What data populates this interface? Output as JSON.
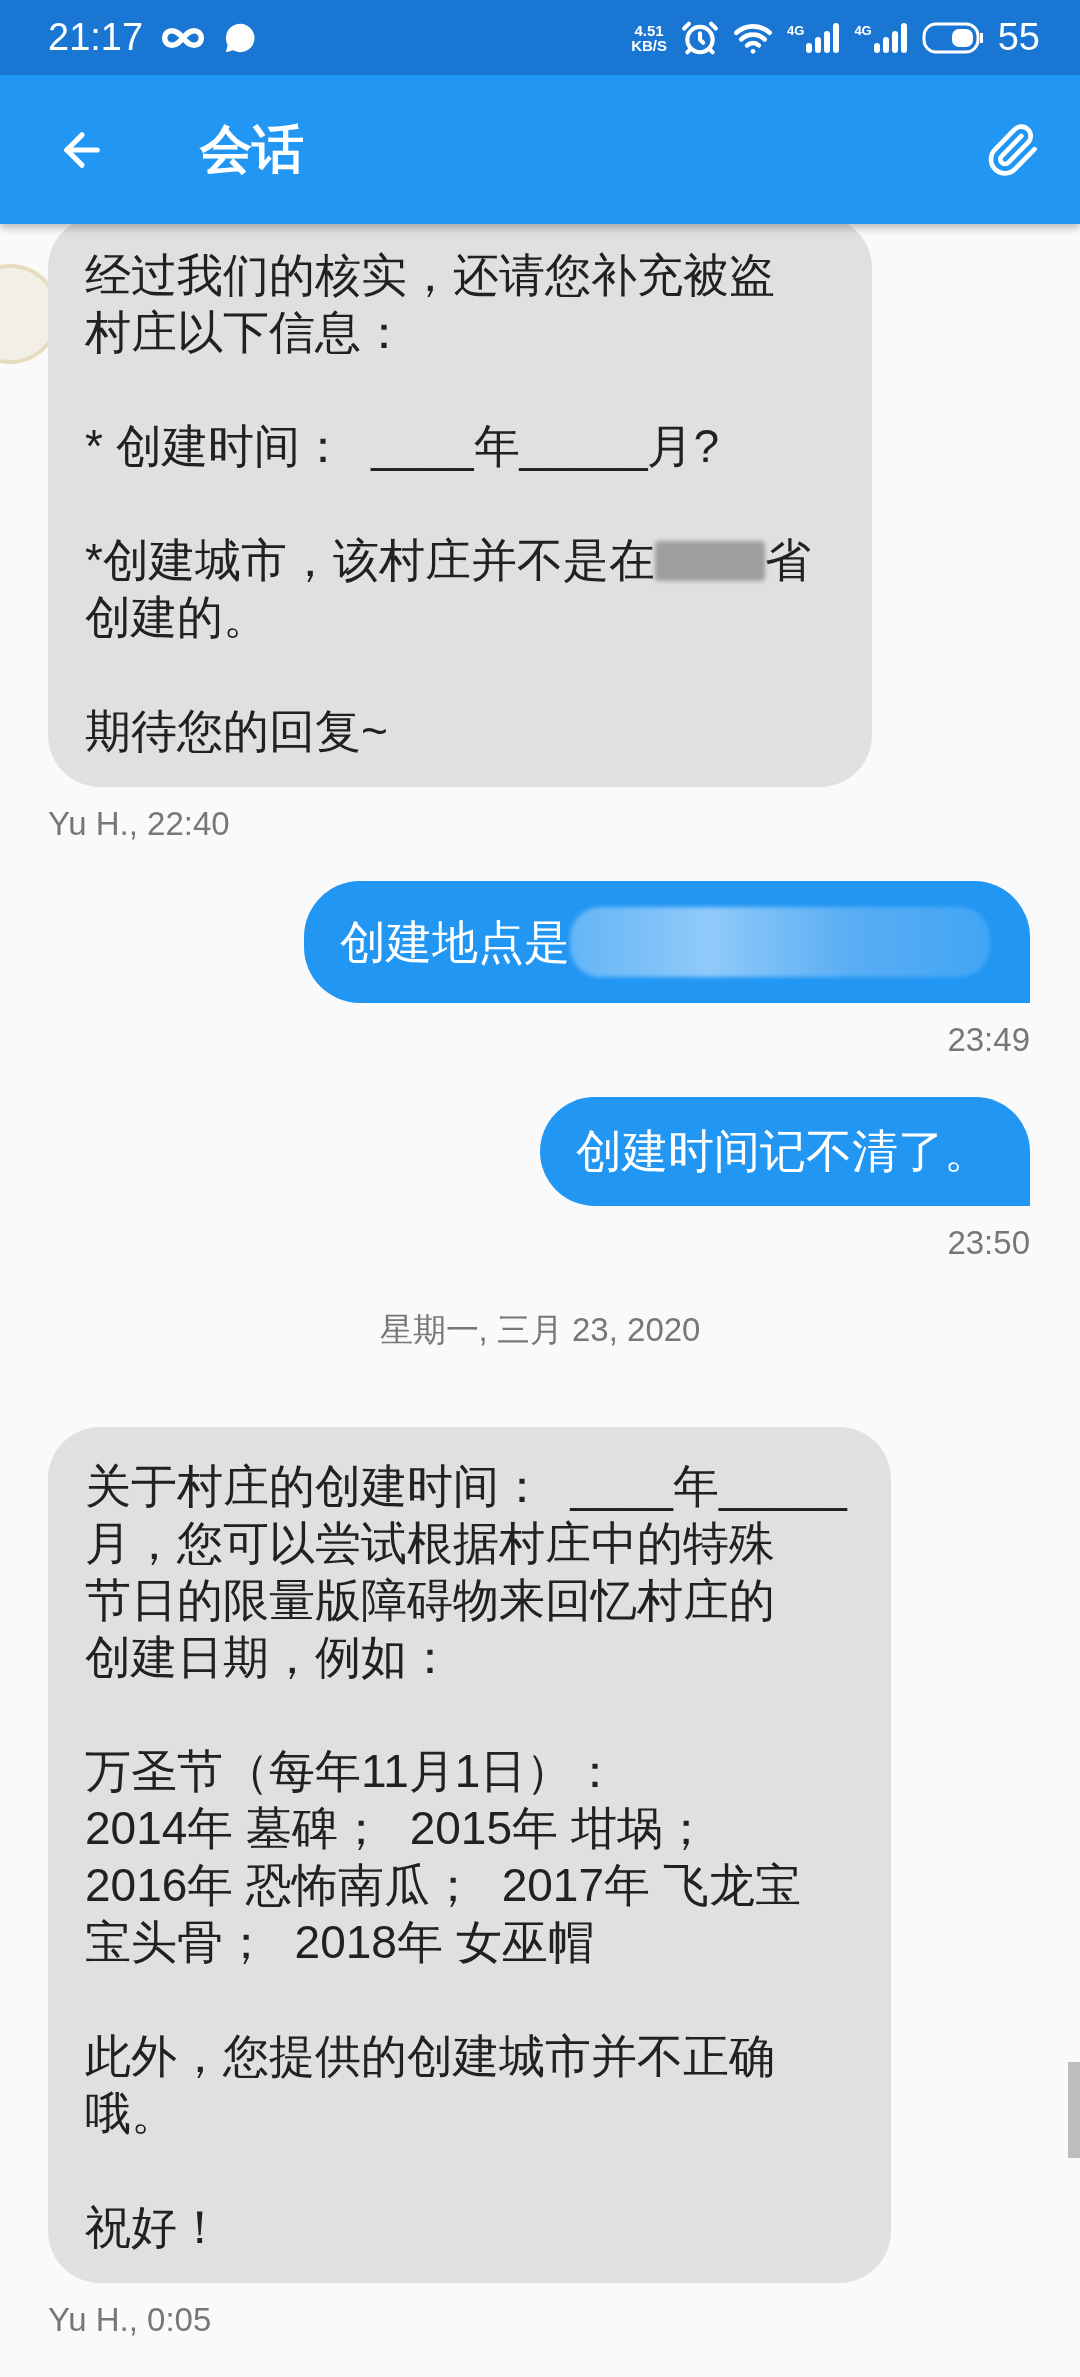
{
  "status_bar": {
    "time": "21:17",
    "speed_value": "4.51",
    "speed_unit": "KB/S",
    "network_labels": [
      "4G",
      "4G"
    ],
    "battery": "55"
  },
  "app_bar": {
    "title": "会话"
  },
  "items": [
    {
      "kind": "incoming",
      "paragraphs": [
        [
          [
            {
              "kind": "text",
              "text": "经过我们的核实，还请您补充被盗"
            }
          ],
          [
            {
              "kind": "text",
              "text": "村庄以下信息："
            }
          ]
        ],
        [
          [
            {
              "kind": "text",
              "text": "* 创建时间：  ____年_____月?"
            }
          ]
        ],
        [
          [
            {
              "kind": "text",
              "text": "*创建城市，该村庄并不是在"
            },
            {
              "kind": "redaction"
            },
            {
              "kind": "text",
              "text": "省"
            }
          ],
          [
            {
              "kind": "text",
              "text": "创建的。"
            }
          ]
        ],
        [
          [
            {
              "kind": "text",
              "text": "期待您的回复~"
            }
          ]
        ]
      ],
      "meta": "Yu H., 22:40"
    },
    {
      "kind": "outgoing",
      "paragraphs": [
        [
          [
            {
              "kind": "text",
              "text": "创建地点是"
            },
            {
              "kind": "redaction"
            }
          ]
        ]
      ],
      "meta": "23:49"
    },
    {
      "kind": "outgoing",
      "paragraphs": [
        [
          [
            {
              "kind": "text",
              "text": "创建时间记不清了。"
            }
          ]
        ]
      ],
      "meta": "23:50"
    },
    {
      "kind": "date",
      "text": "星期一, 三月 23, 2020"
    },
    {
      "kind": "incoming",
      "paragraphs": [
        [
          [
            {
              "kind": "text",
              "text": "关于村庄的创建时间：  ____年_____"
            }
          ],
          [
            {
              "kind": "text",
              "text": "月，您可以尝试根据村庄中的特殊"
            }
          ],
          [
            {
              "kind": "text",
              "text": "节日的限量版障碍物来回忆村庄的"
            }
          ],
          [
            {
              "kind": "text",
              "text": "创建日期，例如："
            }
          ]
        ],
        [
          [
            {
              "kind": "text",
              "text": "万圣节（每年11月1日）："
            }
          ],
          [
            {
              "kind": "text",
              "text": "2014年 墓碑；  2015年 坩埚；"
            }
          ],
          [
            {
              "kind": "text",
              "text": "2016年 恐怖南瓜；  2017年 飞龙宝"
            }
          ],
          [
            {
              "kind": "text",
              "text": "宝头骨；  2018年 女巫帽"
            }
          ]
        ],
        [
          [
            {
              "kind": "text",
              "text": "此外，您提供的创建城市并不正确"
            }
          ],
          [
            {
              "kind": "text",
              "text": "哦。"
            }
          ]
        ],
        [
          [
            {
              "kind": "text",
              "text": "祝好！"
            }
          ]
        ]
      ],
      "meta": "Yu H., 0:05"
    }
  ]
}
